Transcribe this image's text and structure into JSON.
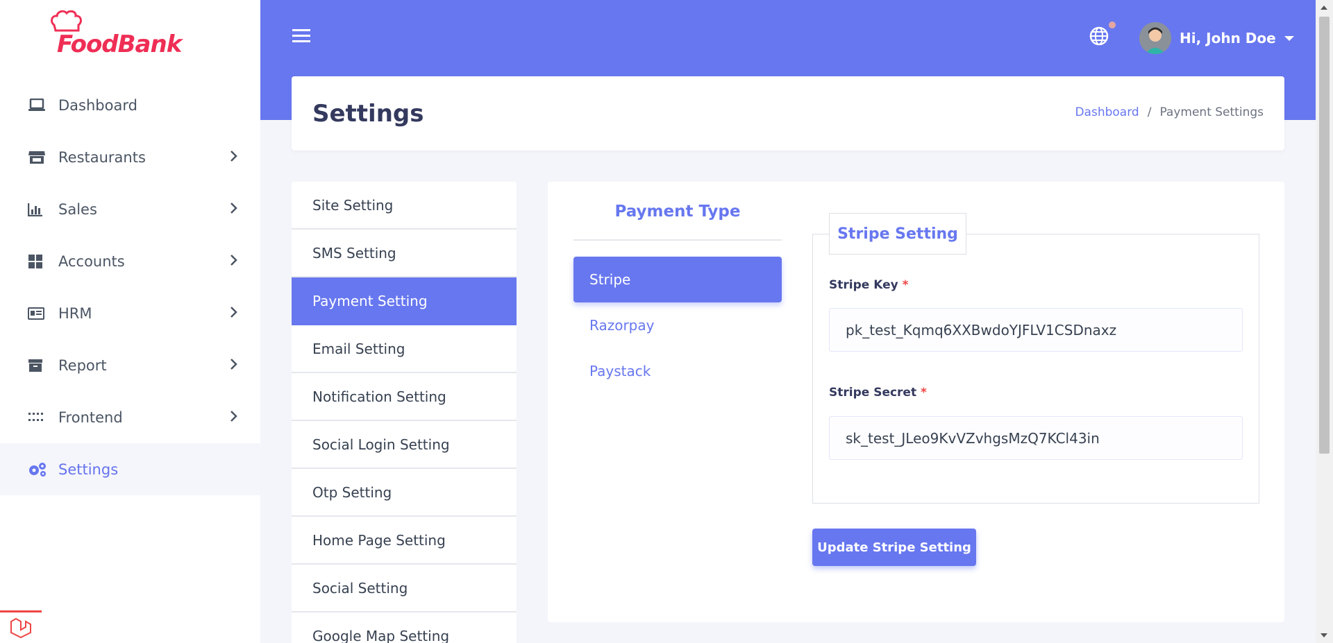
{
  "brand": {
    "name": "FoodBank"
  },
  "sidebar": {
    "items": [
      {
        "label": "Dashboard",
        "icon": "laptop-icon",
        "has_chevron": false
      },
      {
        "label": "Restaurants",
        "icon": "store-icon",
        "has_chevron": true
      },
      {
        "label": "Sales",
        "icon": "bar-chart-icon",
        "has_chevron": true
      },
      {
        "label": "Accounts",
        "icon": "grid-icon",
        "has_chevron": true
      },
      {
        "label": "HRM",
        "icon": "id-card-icon",
        "has_chevron": true
      },
      {
        "label": "Report",
        "icon": "archive-icon",
        "has_chevron": true
      },
      {
        "label": "Frontend",
        "icon": "dots-grid-icon",
        "has_chevron": true
      },
      {
        "label": "Settings",
        "icon": "gears-icon",
        "has_chevron": false,
        "active": true
      }
    ]
  },
  "header": {
    "user_greeting": "Hi, John Doe"
  },
  "page": {
    "title": "Settings",
    "breadcrumb": {
      "home": "Dashboard",
      "separator": "/",
      "current": "Payment Settings"
    }
  },
  "settings_menu": {
    "items": [
      "Site Setting",
      "SMS Setting",
      "Payment Setting",
      "Email Setting",
      "Notification Setting",
      "Social Login Setting",
      "Otp Setting",
      "Home Page Setting",
      "Social Setting",
      "Google Map Setting"
    ],
    "active_index": 2
  },
  "payment": {
    "type_title": "Payment Type",
    "types": [
      "Stripe",
      "Razorpay",
      "Paystack"
    ],
    "active_type": "Stripe",
    "section_title": "Stripe Setting",
    "fields": {
      "key_label": "Stripe Key",
      "key_value": "pk_test_Kqmq6XXBwdoYJFLV1CSDnaxz",
      "secret_label": "Stripe Secret",
      "secret_value": "sk_test_JLeo9KvVZvhgsMzQ7KCl43in",
      "required_mark": "*"
    },
    "submit_label": "Update Stripe Setting"
  },
  "colors": {
    "primary": "#6777ef",
    "brand_red": "#ef2e55",
    "required": "#ef4444"
  }
}
